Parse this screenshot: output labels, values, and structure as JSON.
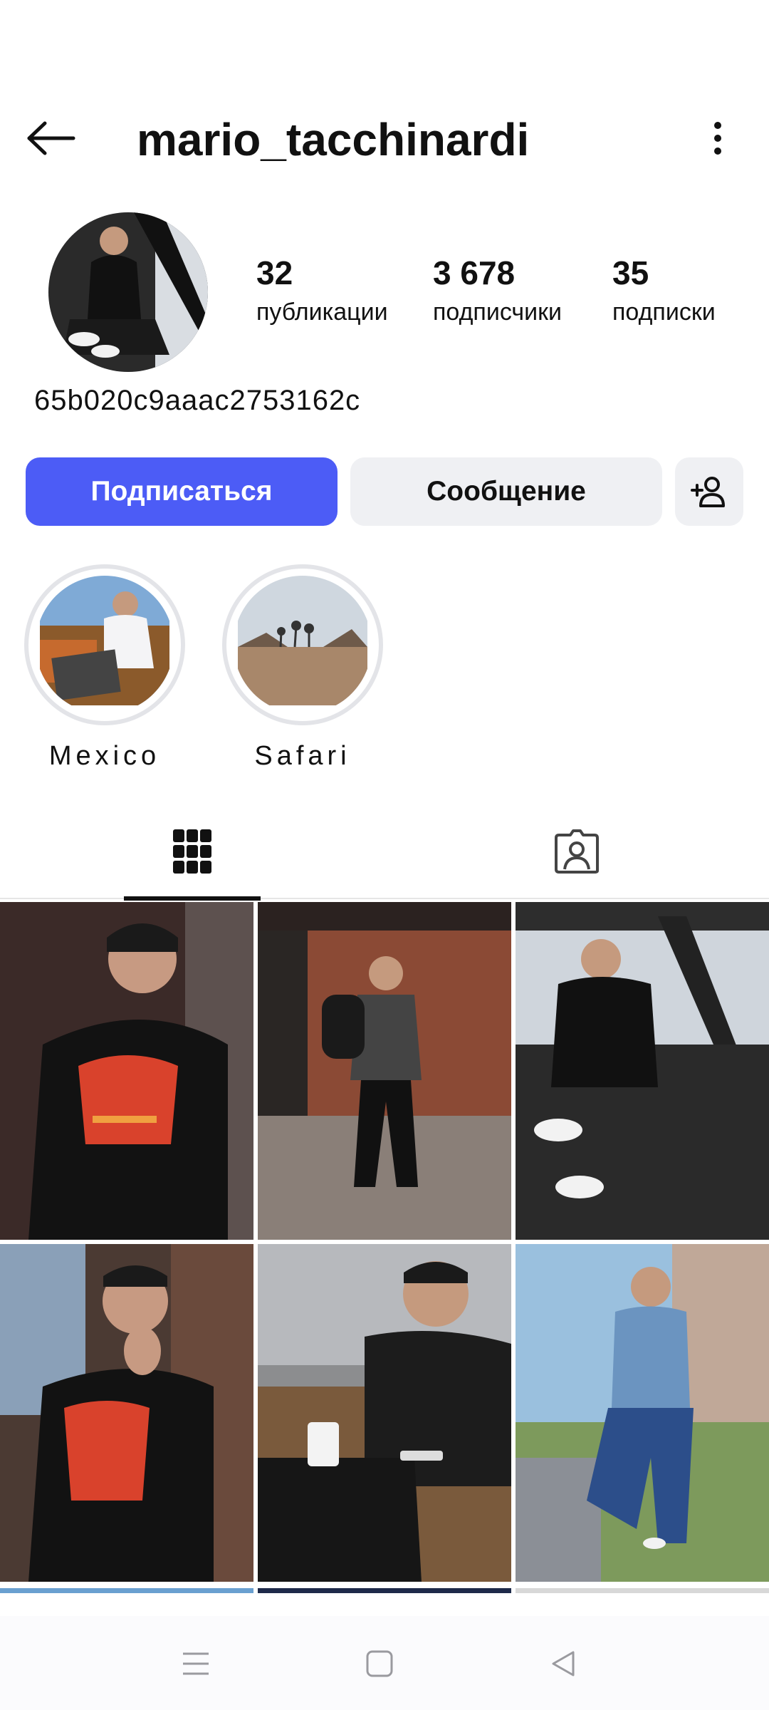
{
  "header": {
    "username": "mario_tacchinardi",
    "back_icon": "arrow-left-icon",
    "more_icon": "more-vertical-icon"
  },
  "profile": {
    "stats": [
      {
        "value": "32",
        "label": "публикации"
      },
      {
        "value": "3 678",
        "label": "подписчики"
      },
      {
        "value": "35",
        "label": "подписки"
      }
    ],
    "bio": "65b020c9aaac2753162c"
  },
  "actions": {
    "follow": "Подписаться",
    "message": "Сообщение",
    "add_user_icon": "person-add-icon"
  },
  "highlights": [
    {
      "label": "Mexico"
    },
    {
      "label": "Safari"
    }
  ],
  "tabs": {
    "grid_icon": "grid-icon",
    "tagged_icon": "tagged-person-icon",
    "active": "grid"
  },
  "colors": {
    "accent": "#4c5cf6",
    "secondary_button": "#eff0f3",
    "text": "#111111"
  },
  "navbar": {
    "menu_icon": "menu-icon",
    "home_icon": "square-home-icon",
    "back_icon": "triangle-back-icon"
  }
}
